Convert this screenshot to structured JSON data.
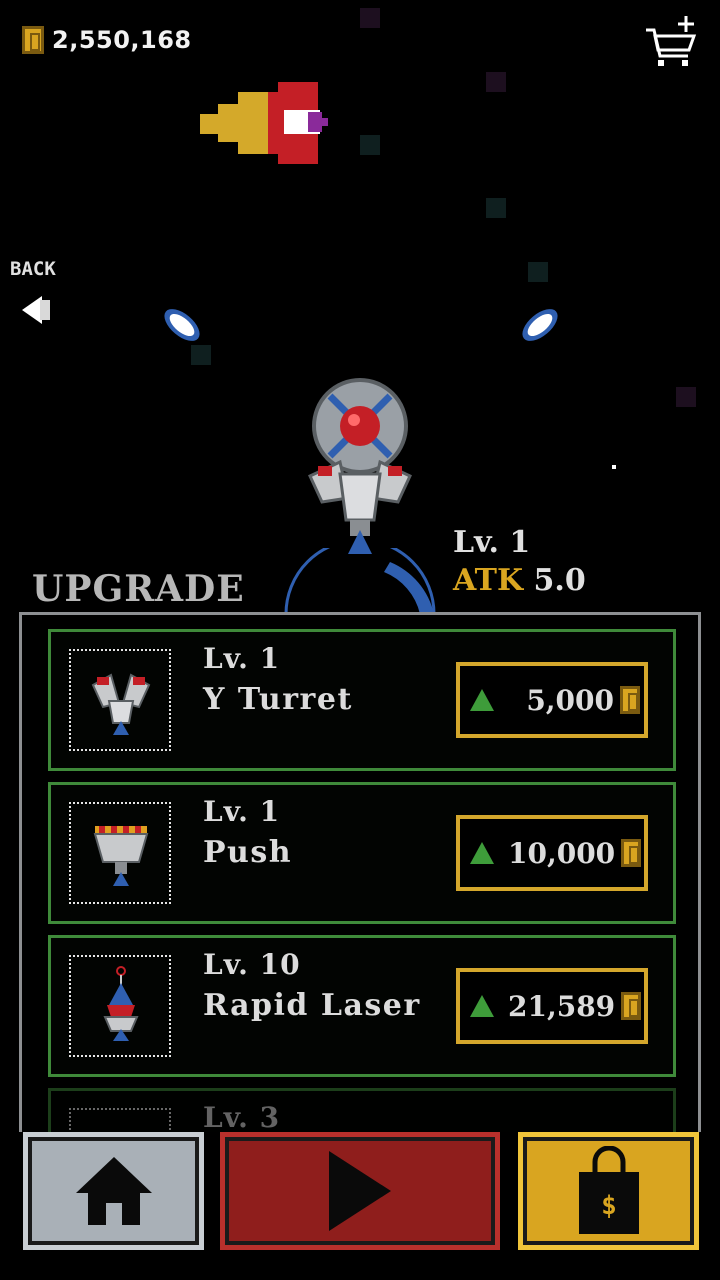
{
  "header": {
    "coin_amount": "2,550,168",
    "coin_icon": "coin-icon",
    "cart_icon": "cart-icon"
  },
  "back": {
    "label": "BACK",
    "icon": "back-arrow-icon"
  },
  "ship": {
    "level": "Lv. 1",
    "atk_key": "ATK",
    "atk_value": "5.0"
  },
  "upgrade": {
    "title": "UPGRADE",
    "items": [
      {
        "level": "Lv. 1",
        "name": "Y Turret",
        "price": "5,000",
        "icon": "y-turret-icon"
      },
      {
        "level": "Lv. 1",
        "name": "Push",
        "price": "10,000",
        "icon": "push-turret-icon"
      },
      {
        "level": "Lv. 10",
        "name": "Rapid Laser",
        "price": "21,589",
        "icon": "rapid-laser-icon"
      },
      {
        "level": "Lv. 3",
        "name": "",
        "price": "",
        "icon": ""
      }
    ]
  },
  "nav": {
    "home_icon": "home-icon",
    "play_icon": "play-icon",
    "shop_icon": "shopping-bag-icon"
  },
  "colors": {
    "gold": "#d9a520",
    "green_border": "#3f8a3a",
    "play_red": "#8f1e1c",
    "home_gray": "#a9b0b7"
  }
}
